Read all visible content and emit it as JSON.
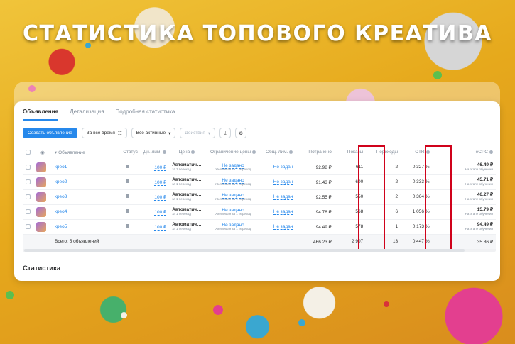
{
  "headline": "СТАТИСТИКА ТОПОВОГО КРЕАТИВА",
  "tabs": [
    {
      "label": "Объявления",
      "active": true
    },
    {
      "label": "Детализация",
      "active": false
    },
    {
      "label": "Подробная статистика",
      "active": false
    }
  ],
  "toolbar": {
    "create_label": "Создать объявление",
    "period_label": "За всё время",
    "filter_label": "Все активные",
    "actions_label": "Действия"
  },
  "columns": {
    "name": "Объявление",
    "status": "Статус",
    "daily_limit": "Дн. лим.",
    "price": "Цена",
    "price_limit": "Ограничение цены",
    "total_limit": "Общ. лим.",
    "spent": "Потрачено",
    "impressions": "Показы",
    "clicks": "Переходы",
    "ctr": "CTR",
    "ecpc": "eCPC"
  },
  "rows": [
    {
      "name": "креo1",
      "daily_limit": "100 ₽",
      "price_main": "Автоматич…",
      "price_sub": "за 1 переход",
      "pl_main": "Не задано",
      "pl_sub": "Желаемая за 1 переход",
      "total_limit": "Не задан",
      "spent": "92.98 ₽",
      "impressions": "611",
      "clicks": "2",
      "ctr": "0.327 %",
      "ecpc_main": "46.49 ₽",
      "ecpc_sub": "На этапе обучения"
    },
    {
      "name": "креo2",
      "daily_limit": "100 ₽",
      "price_main": "Автоматич…",
      "price_sub": "за 1 переход",
      "pl_main": "Не задано",
      "pl_sub": "Желаемая за 1 переход",
      "total_limit": "Не задан",
      "spent": "91.43 ₽",
      "impressions": "600",
      "clicks": "2",
      "ctr": "0.333 %",
      "ecpc_main": "45.71 ₽",
      "ecpc_sub": "На этапе обучения"
    },
    {
      "name": "креo3",
      "daily_limit": "100 ₽",
      "price_main": "Автоматич…",
      "price_sub": "за 1 переход",
      "pl_main": "Не задано",
      "pl_sub": "Желаемая за 1 переход",
      "total_limit": "Не задан",
      "spent": "92.55 ₽",
      "impressions": "550",
      "clicks": "2",
      "ctr": "0.364 %",
      "ecpc_main": "46.27 ₽",
      "ecpc_sub": "На этапе обучения"
    },
    {
      "name": "креo4",
      "daily_limit": "100 ₽",
      "price_main": "Автоматич…",
      "price_sub": "за 1 переход",
      "pl_main": "Не задано",
      "pl_sub": "Желаемая за 1 переход",
      "total_limit": "Не задан",
      "spent": "94.78 ₽",
      "impressions": "568",
      "clicks": "6",
      "ctr": "1.056 %",
      "ecpc_main": "15.79 ₽",
      "ecpc_sub": "На этапе обучения"
    },
    {
      "name": "креo5",
      "daily_limit": "100 ₽",
      "price_main": "Автоматич…",
      "price_sub": "за 1 переход",
      "pl_main": "Не задано",
      "pl_sub": "Желаемая за 1 переход",
      "total_limit": "Не задан",
      "spent": "94.49 ₽",
      "impressions": "578",
      "clicks": "1",
      "ctr": "0.173 %",
      "ecpc_main": "94.49 ₽",
      "ecpc_sub": "На этапе обучения"
    }
  ],
  "totals": {
    "label": "Всего: 5 объявлений",
    "spent": "466.23 ₽",
    "impressions": "2 907",
    "clicks": "13",
    "ctr": "0.447 %",
    "ecpc": "35.86 ₽"
  },
  "statistics_title": "Статистика",
  "colors": {
    "accent": "#2688eb",
    "highlight": "#d0021b"
  }
}
